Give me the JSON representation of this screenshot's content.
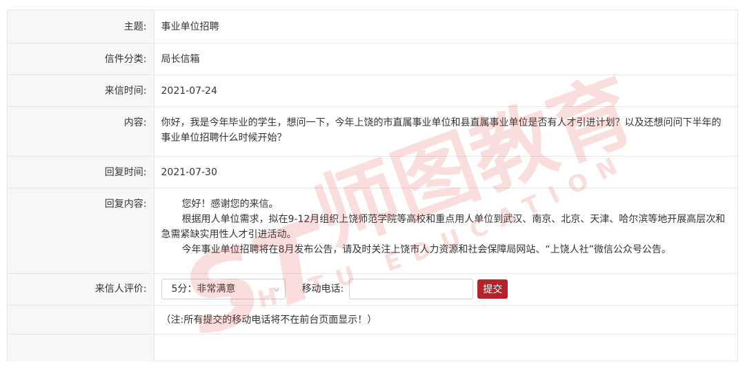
{
  "rows": {
    "subject": {
      "label": "主题:",
      "value": "事业单位招聘"
    },
    "category": {
      "label": "信件分类:",
      "value": "局长信箱"
    },
    "date": {
      "label": "来信时间:",
      "value": "2021-07-24"
    },
    "content": {
      "label": "内容:",
      "value": "你好，我是今年毕业的学生，想问一下，今年上饶的市直属事业单位和县直属事业单位是否有人才引进计划？以及还想问问下半年的事业单位招聘什么时候开始？"
    },
    "reply_date": {
      "label": "回复时间:",
      "value": "2021-07-30"
    },
    "reply": {
      "label": "回复内容:",
      "paragraphs": [
        "您好！感谢您的来信。",
        "根据用人单位需求，拟在9-12月组织上饶师范学院等高校和重点用人单位到武汉、南京、北京、天津、哈尔滨等地开展高层次和急需紧缺实用性人才引进活动。",
        "今年事业单位招聘将在8月发布公告，请及时关注上饶市人力资源和社会保障局网站、“上饶人社”微信公众号公告。"
      ]
    },
    "rating": {
      "label": "来信人评价:",
      "selected": "5分：非常满意",
      "phone_label": "移动电话:",
      "phone_value": "",
      "submit_label": "提交"
    },
    "note": "（注:所有提交的移动电话将不在前台页面显示！）"
  },
  "watermark": {
    "brand": "师图教育",
    "logo": "ST",
    "sub": "SHITU EDUCATION",
    "color": "#e23b33"
  }
}
